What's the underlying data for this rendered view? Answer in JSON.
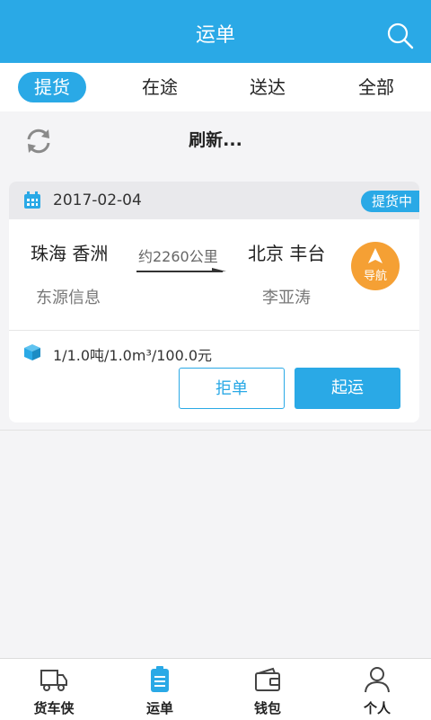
{
  "header": {
    "title": "运单"
  },
  "tabs": [
    {
      "label": "提货",
      "active": true
    },
    {
      "label": "在途",
      "active": false
    },
    {
      "label": "送达",
      "active": false
    },
    {
      "label": "全部",
      "active": false
    }
  ],
  "refresh": {
    "text": "刷新..."
  },
  "order": {
    "date": "2017-02-04",
    "status": "提货中",
    "from_city": "珠海 香洲",
    "to_city": "北京 丰台",
    "distance": "约2260公里",
    "from_company": "东源信息",
    "to_person": "李亚涛",
    "nav_label": "导航",
    "cargo": "1/1.0吨/1.0m³/100.0元",
    "reject_label": "拒单",
    "start_label": "起运"
  },
  "bottom_nav": [
    {
      "label": "货车侠",
      "icon": "truck-icon"
    },
    {
      "label": "运单",
      "icon": "clipboard-icon"
    },
    {
      "label": "钱包",
      "icon": "wallet-icon"
    },
    {
      "label": "个人",
      "icon": "user-icon"
    }
  ],
  "colors": {
    "accent": "#2aa9e6",
    "nav_orange": "#f5a034"
  }
}
